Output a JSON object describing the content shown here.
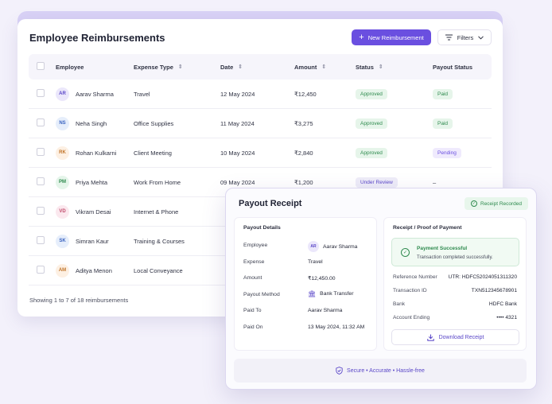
{
  "header": {
    "title": "Employee Reimbursements",
    "new_button": "New Reimbursement",
    "filter_button": "Filters"
  },
  "table": {
    "columns": [
      "Employee",
      "Expense Type",
      "Date",
      "Amount",
      "Status",
      "Payout Status"
    ],
    "rows": [
      {
        "initials": "AR",
        "name": "Aarav Sharma",
        "type": "Travel",
        "date": "12 May 2024",
        "amount": "₹12,450",
        "status": "Approved",
        "payout": "Paid"
      },
      {
        "initials": "NS",
        "name": "Neha Singh",
        "type": "Office Supplies",
        "date": "11 May 2024",
        "amount": "₹3,275",
        "status": "Approved",
        "payout": "Paid"
      },
      {
        "initials": "RK",
        "name": "Rohan Kulkarni",
        "type": "Client Meeting",
        "date": "10 May 2024",
        "amount": "₹2,840",
        "status": "Approved",
        "payout": "Pending"
      },
      {
        "initials": "PM",
        "name": "Priya Mehta",
        "type": "Work From Home",
        "date": "09 May 2024",
        "amount": "₹1,200",
        "status": "Under Review",
        "payout": "–"
      },
      {
        "initials": "VD",
        "name": "Vikram Desai",
        "type": "Internet & Phone",
        "date": "",
        "amount": "",
        "status": "",
        "payout": ""
      },
      {
        "initials": "SK",
        "name": "Simran Kaur",
        "type": "Training & Courses",
        "date": "",
        "amount": "",
        "status": "",
        "payout": ""
      },
      {
        "initials": "AM",
        "name": "Aditya Menon",
        "type": "Local Conveyance",
        "date": "",
        "amount": "",
        "status": "",
        "payout": ""
      }
    ],
    "footer": "Showing 1 to 7 of 18 reimbursements"
  },
  "receipt": {
    "title": "Payout Receipt",
    "recorded_badge": "Receipt Recorded",
    "details_title": "Payout Details",
    "details": [
      {
        "label": "Employee",
        "value": "Aarav Sharma"
      },
      {
        "label": "Expense",
        "value": "Travel"
      },
      {
        "label": "Amount",
        "value": "₹12,450.00"
      },
      {
        "label": "Payout Method",
        "value": "Bank Transfer"
      },
      {
        "label": "Paid To",
        "value": "Aarav Sharma"
      },
      {
        "label": "Paid On",
        "value": "13 May 2024, 11:32 AM"
      }
    ],
    "employee_initials": "AR",
    "proof_title": "Receipt / Proof of Payment",
    "success_title": "Payment Successful",
    "success_sub": "Transaction completed successfully.",
    "proof": [
      {
        "label": "Reference Number",
        "value": "UTR: HDFC52024051311320"
      },
      {
        "label": "Transaction ID",
        "value": "TXN512345678901"
      },
      {
        "label": "Bank",
        "value": "HDFC Bank"
      },
      {
        "label": "Account Ending",
        "value": "•••• 4321"
      }
    ],
    "download_button": "Download Receipt",
    "footer_text": "Secure • Accurate • Hassle-free"
  },
  "colors": {
    "accent": "#6a4fe0",
    "approved_bg": "#e6f5ea",
    "approved_fg": "#2e8a4e",
    "pending_bg": "#efeafd",
    "pending_fg": "#6a4fe0",
    "review_bg": "#eeecf8",
    "review_fg": "#5a47c8"
  }
}
